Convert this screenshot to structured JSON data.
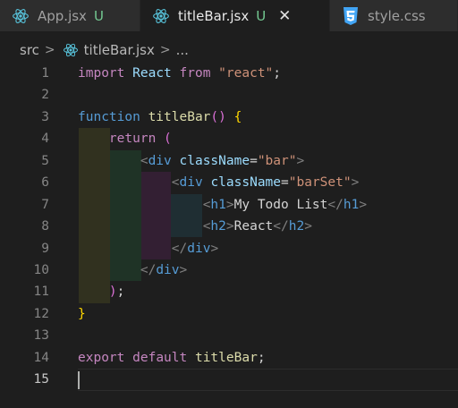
{
  "tabs": [
    {
      "label": "App.jsx",
      "badge": "U",
      "icon": "react-icon"
    },
    {
      "label": "titleBar.jsx",
      "badge": "U",
      "icon": "react-icon",
      "active": true,
      "close": "✕"
    },
    {
      "label": "style.css",
      "icon": "css-icon"
    }
  ],
  "breadcrumb": {
    "folder": "src",
    "file": "titleBar.jsx",
    "more": "..."
  },
  "line_numbers": [
    "1",
    "2",
    "3",
    "4",
    "5",
    "6",
    "7",
    "8",
    "9",
    "10",
    "11",
    "12",
    "13",
    "14",
    "15"
  ],
  "code": {
    "l1": {
      "kw": "import",
      "name": "React",
      "from": "from",
      "str": "\"react\"",
      "semi": ";"
    },
    "l3": {
      "kw": "function",
      "name": "titleBar",
      "parens": "()",
      "brace": "{"
    },
    "l4": {
      "kw": "return",
      "paren": "("
    },
    "l5": {
      "open": "<",
      "tag": "div",
      "attr": "className",
      "eq": "=",
      "str": "\"bar\"",
      "close": ">"
    },
    "l6": {
      "open": "<",
      "tag": "div",
      "attr": "className",
      "eq": "=",
      "str": "\"barSet\"",
      "close": ">"
    },
    "l7": {
      "open": "<",
      "tag": "h1",
      "close": ">",
      "text": "My Todo List",
      "end_open": "</",
      "end_tag": "h1",
      "end_close": ">"
    },
    "l8": {
      "open": "<",
      "tag": "h2",
      "close": ">",
      "text": "React",
      "end_open": "</",
      "end_tag": "h2",
      "end_close": ">"
    },
    "l9": {
      "open": "</",
      "tag": "div",
      "close": ">"
    },
    "l10": {
      "open": "</",
      "tag": "div",
      "close": ">"
    },
    "l11": {
      "paren": ")",
      "semi": ";"
    },
    "l12": {
      "brace": "}"
    },
    "l14": {
      "kw1": "export",
      "kw2": "default",
      "name": "titleBar",
      "semi": ";"
    }
  },
  "colors": {
    "background": "#1e1e1e",
    "git_untracked": "#73c991",
    "react": "#58c4dc",
    "css": "#42a5f5"
  }
}
